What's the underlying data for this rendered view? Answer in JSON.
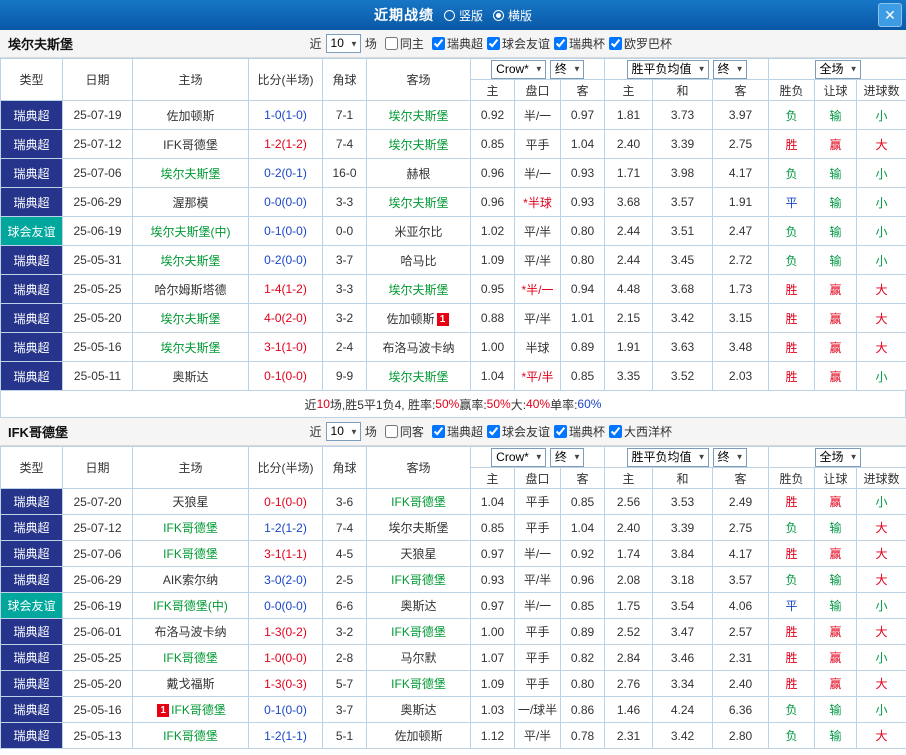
{
  "titlebar": {
    "title": "近期战绩",
    "layout_options": [
      {
        "label": "竖版",
        "selected": false
      },
      {
        "label": "横版",
        "selected": true
      }
    ],
    "close": "✕"
  },
  "table_header": {
    "type": "类型",
    "date": "日期",
    "home": "主场",
    "score": "比分(半场)",
    "corner": "角球",
    "away": "客场",
    "crown_select": "Crow*",
    "final_select": "终",
    "avg_select": "胜平负均值",
    "final_select2": "终",
    "fulltime_select": "全场",
    "sub": {
      "h": "主",
      "hcap": "盘口",
      "a": "客",
      "h2": "主",
      "d": "和",
      "a2": "客",
      "wdl": "胜负",
      "hcap_r": "让球",
      "goals": "进球数"
    }
  },
  "sections": [
    {
      "team": "埃尔夫斯堡",
      "filters": {
        "recent_label": "近",
        "recent_value": "10",
        "recent_suffix": "场",
        "same_label": "同主",
        "same_checked": false,
        "comps": [
          {
            "label": "瑞典超",
            "checked": true
          },
          {
            "label": "球会友谊",
            "checked": true
          },
          {
            "label": "瑞典杯",
            "checked": true
          },
          {
            "label": "欧罗巴杯",
            "checked": true
          }
        ]
      },
      "rows": [
        {
          "type": "瑞典超",
          "date": "25-07-19",
          "home": "佐加顿斯",
          "home_focal": false,
          "score": "1-0(1-0)",
          "result": "l",
          "corner": "7-1",
          "away": "埃尔夫斯堡",
          "away_focal": true,
          "crown": [
            "0.92",
            "半/一",
            "0.97"
          ],
          "odds": [
            "1.81",
            "3.73",
            "3.97"
          ],
          "wdl": "负",
          "hcap": "输",
          "goals": "小"
        },
        {
          "type": "瑞典超",
          "date": "25-07-12",
          "home": "IFK哥德堡",
          "home_focal": false,
          "score": "1-2(1-2)",
          "result": "w",
          "corner": "7-4",
          "away": "埃尔夫斯堡",
          "away_focal": true,
          "crown": [
            "0.85",
            "平手",
            "1.04"
          ],
          "odds": [
            "2.40",
            "3.39",
            "2.75"
          ],
          "wdl": "胜",
          "hcap": "赢",
          "goals": "大"
        },
        {
          "type": "瑞典超",
          "date": "25-07-06",
          "home": "埃尔夫斯堡",
          "home_focal": true,
          "score": "0-2(0-1)",
          "result": "l",
          "corner": "16-0",
          "away": "赫根",
          "away_focal": false,
          "crown": [
            "0.96",
            "半/一",
            "0.93"
          ],
          "odds": [
            "1.71",
            "3.98",
            "4.17"
          ],
          "wdl": "负",
          "hcap": "输",
          "goals": "小"
        },
        {
          "type": "瑞典超",
          "date": "25-06-29",
          "home": "渥那模",
          "home_focal": false,
          "score": "0-0(0-0)",
          "result": "d",
          "corner": "3-3",
          "away": "埃尔夫斯堡",
          "away_focal": true,
          "crown": [
            "0.96",
            "*半球",
            "0.93"
          ],
          "odds": [
            "3.68",
            "3.57",
            "1.91"
          ],
          "wdl": "平",
          "hcap": "输",
          "goals": "小"
        },
        {
          "type": "球会友谊",
          "date": "25-06-19",
          "home": "埃尔夫斯堡(中)",
          "home_focal": true,
          "score": "0-1(0-0)",
          "result": "l",
          "corner": "0-0",
          "away": "米亚尔比",
          "away_focal": false,
          "crown": [
            "1.02",
            "平/半",
            "0.80"
          ],
          "odds": [
            "2.44",
            "3.51",
            "2.47"
          ],
          "wdl": "负",
          "hcap": "输",
          "goals": "小"
        },
        {
          "type": "瑞典超",
          "date": "25-05-31",
          "home": "埃尔夫斯堡",
          "home_focal": true,
          "score": "0-2(0-0)",
          "result": "l",
          "corner": "3-7",
          "away": "哈马比",
          "away_focal": false,
          "crown": [
            "1.09",
            "平/半",
            "0.80"
          ],
          "odds": [
            "2.44",
            "3.45",
            "2.72"
          ],
          "wdl": "负",
          "hcap": "输",
          "goals": "小"
        },
        {
          "type": "瑞典超",
          "date": "25-05-25",
          "home": "哈尔姆斯塔德",
          "home_focal": false,
          "score": "1-4(1-2)",
          "result": "w",
          "corner": "3-3",
          "away": "埃尔夫斯堡",
          "away_focal": true,
          "crown": [
            "0.95",
            "*半/一",
            "0.94"
          ],
          "odds": [
            "4.48",
            "3.68",
            "1.73"
          ],
          "wdl": "胜",
          "hcap": "赢",
          "goals": "大"
        },
        {
          "type": "瑞典超",
          "date": "25-05-20",
          "home": "埃尔夫斯堡",
          "home_focal": true,
          "score": "4-0(2-0)",
          "result": "w",
          "corner": "3-2",
          "away": "佐加顿斯",
          "away_focal": false,
          "away_card": {
            "n": "1",
            "pos": "after"
          },
          "crown": [
            "0.88",
            "平/半",
            "1.01"
          ],
          "odds": [
            "2.15",
            "3.42",
            "3.15"
          ],
          "wdl": "胜",
          "hcap": "赢",
          "goals": "大"
        },
        {
          "type": "瑞典超",
          "date": "25-05-16",
          "home": "埃尔夫斯堡",
          "home_focal": true,
          "score": "3-1(1-0)",
          "result": "w",
          "corner": "2-4",
          "away": "布洛马波卡纳",
          "away_focal": false,
          "crown": [
            "1.00",
            "半球",
            "0.89"
          ],
          "odds": [
            "1.91",
            "3.63",
            "3.48"
          ],
          "wdl": "胜",
          "hcap": "赢",
          "goals": "大"
        },
        {
          "type": "瑞典超",
          "date": "25-05-11",
          "home": "奥斯达",
          "home_focal": false,
          "score": "0-1(0-0)",
          "result": "w",
          "corner": "9-9",
          "away": "埃尔夫斯堡",
          "away_focal": true,
          "crown": [
            "1.04",
            "*平/半",
            "0.85"
          ],
          "odds": [
            "3.35",
            "3.52",
            "2.03"
          ],
          "wdl": "胜",
          "hcap": "赢",
          "goals": "小"
        }
      ],
      "footer": [
        {
          "t": "近",
          "c": "#333333"
        },
        {
          "t": "10",
          "c": "#e2001a"
        },
        {
          "t": "场,胜5平1负4, 胜率:",
          "c": "#333333"
        },
        {
          "t": "50%",
          "c": "#e2001a"
        },
        {
          "t": " 赢率:",
          "c": "#333333"
        },
        {
          "t": "50%",
          "c": "#e2001a"
        },
        {
          "t": " 大:",
          "c": "#333333"
        },
        {
          "t": "40%",
          "c": "#e2001a"
        },
        {
          "t": " 单率:",
          "c": "#333333"
        },
        {
          "t": "60%",
          "c": "#1a46c8"
        }
      ]
    },
    {
      "team": "IFK哥德堡",
      "filters": {
        "recent_label": "近",
        "recent_value": "10",
        "recent_suffix": "场",
        "same_label": "同客",
        "same_checked": false,
        "comps": [
          {
            "label": "瑞典超",
            "checked": true
          },
          {
            "label": "球会友谊",
            "checked": true
          },
          {
            "label": "瑞典杯",
            "checked": true
          },
          {
            "label": "大西洋杯",
            "checked": true
          }
        ]
      },
      "rows": [
        {
          "type": "瑞典超",
          "date": "25-07-20",
          "home": "天狼星",
          "home_focal": false,
          "score": "0-1(0-0)",
          "result": "w",
          "corner": "3-6",
          "away": "IFK哥德堡",
          "away_focal": true,
          "crown": [
            "1.04",
            "平手",
            "0.85"
          ],
          "odds": [
            "2.56",
            "3.53",
            "2.49"
          ],
          "wdl": "胜",
          "hcap": "赢",
          "goals": "小"
        },
        {
          "type": "瑞典超",
          "date": "25-07-12",
          "home": "IFK哥德堡",
          "home_focal": true,
          "score": "1-2(1-2)",
          "result": "l",
          "corner": "7-4",
          "away": "埃尔夫斯堡",
          "away_focal": false,
          "crown": [
            "0.85",
            "平手",
            "1.04"
          ],
          "odds": [
            "2.40",
            "3.39",
            "2.75"
          ],
          "wdl": "负",
          "hcap": "输",
          "goals": "大"
        },
        {
          "type": "瑞典超",
          "date": "25-07-06",
          "home": "IFK哥德堡",
          "home_focal": true,
          "score": "3-1(1-1)",
          "result": "w",
          "corner": "4-5",
          "away": "天狼星",
          "away_focal": false,
          "crown": [
            "0.97",
            "半/一",
            "0.92"
          ],
          "odds": [
            "1.74",
            "3.84",
            "4.17"
          ],
          "wdl": "胜",
          "hcap": "赢",
          "goals": "大"
        },
        {
          "type": "瑞典超",
          "date": "25-06-29",
          "home": "AIK索尔纳",
          "home_focal": false,
          "score": "3-0(2-0)",
          "result": "l",
          "corner": "2-5",
          "away": "IFK哥德堡",
          "away_focal": true,
          "crown": [
            "0.93",
            "平/半",
            "0.96"
          ],
          "odds": [
            "2.08",
            "3.18",
            "3.57"
          ],
          "wdl": "负",
          "hcap": "输",
          "goals": "大"
        },
        {
          "type": "球会友谊",
          "date": "25-06-19",
          "home": "IFK哥德堡(中)",
          "home_focal": true,
          "score": "0-0(0-0)",
          "result": "d",
          "corner": "6-6",
          "away": "奥斯达",
          "away_focal": false,
          "crown": [
            "0.97",
            "半/一",
            "0.85"
          ],
          "odds": [
            "1.75",
            "3.54",
            "4.06"
          ],
          "wdl": "平",
          "hcap": "输",
          "goals": "小"
        },
        {
          "type": "瑞典超",
          "date": "25-06-01",
          "home": "布洛马波卡纳",
          "home_focal": false,
          "score": "1-3(0-2)",
          "result": "w",
          "corner": "3-2",
          "away": "IFK哥德堡",
          "away_focal": true,
          "crown": [
            "1.00",
            "平手",
            "0.89"
          ],
          "odds": [
            "2.52",
            "3.47",
            "2.57"
          ],
          "wdl": "胜",
          "hcap": "赢",
          "goals": "大"
        },
        {
          "type": "瑞典超",
          "date": "25-05-25",
          "home": "IFK哥德堡",
          "home_focal": true,
          "score": "1-0(0-0)",
          "result": "w",
          "corner": "2-8",
          "away": "马尔默",
          "away_focal": false,
          "crown": [
            "1.07",
            "平手",
            "0.82"
          ],
          "odds": [
            "2.84",
            "3.46",
            "2.31"
          ],
          "wdl": "胜",
          "hcap": "赢",
          "goals": "小"
        },
        {
          "type": "瑞典超",
          "date": "25-05-20",
          "home": "戴戈福斯",
          "home_focal": false,
          "score": "1-3(0-3)",
          "result": "w",
          "corner": "5-7",
          "away": "IFK哥德堡",
          "away_focal": true,
          "crown": [
            "1.09",
            "平手",
            "0.80"
          ],
          "odds": [
            "2.76",
            "3.34",
            "2.40"
          ],
          "wdl": "胜",
          "hcap": "赢",
          "goals": "大"
        },
        {
          "type": "瑞典超",
          "date": "25-05-16",
          "home": "IFK哥德堡",
          "home_focal": true,
          "home_card": {
            "n": "1",
            "pos": "before"
          },
          "score": "0-1(0-0)",
          "result": "l",
          "corner": "3-7",
          "away": "奥斯达",
          "away_focal": false,
          "crown": [
            "1.03",
            "一/球半",
            "0.86"
          ],
          "odds": [
            "1.46",
            "4.24",
            "6.36"
          ],
          "wdl": "负",
          "hcap": "输",
          "goals": "小"
        },
        {
          "type": "瑞典超",
          "date": "25-05-13",
          "home": "IFK哥德堡",
          "home_focal": true,
          "score": "1-2(1-1)",
          "result": "l",
          "corner": "5-1",
          "away": "佐加顿斯",
          "away_focal": false,
          "crown": [
            "1.12",
            "平/半",
            "0.78"
          ],
          "odds": [
            "2.31",
            "3.42",
            "2.80"
          ],
          "wdl": "负",
          "hcap": "输",
          "goals": "大"
        }
      ]
    }
  ],
  "colors": {
    "titlebar_bg": "#0d63b0",
    "type_colors": {
      "瑞典超": "#27348b",
      "球会友谊": "#00a79d"
    },
    "focal_team": "#009933",
    "plain_team": "#333333",
    "result_score": {
      "w": "#e2001a",
      "d": "#1a46c8",
      "l": "#1a46c8"
    },
    "char_colors": {
      "胜": "#e2001a",
      "负": "#009944",
      "平": "#1a46c8",
      "赢": "#e2001a",
      "输": "#009944",
      "大": "#e2001a",
      "小": "#009944"
    },
    "star_handicap": "#e2001a",
    "card_badge": "#e60012"
  }
}
